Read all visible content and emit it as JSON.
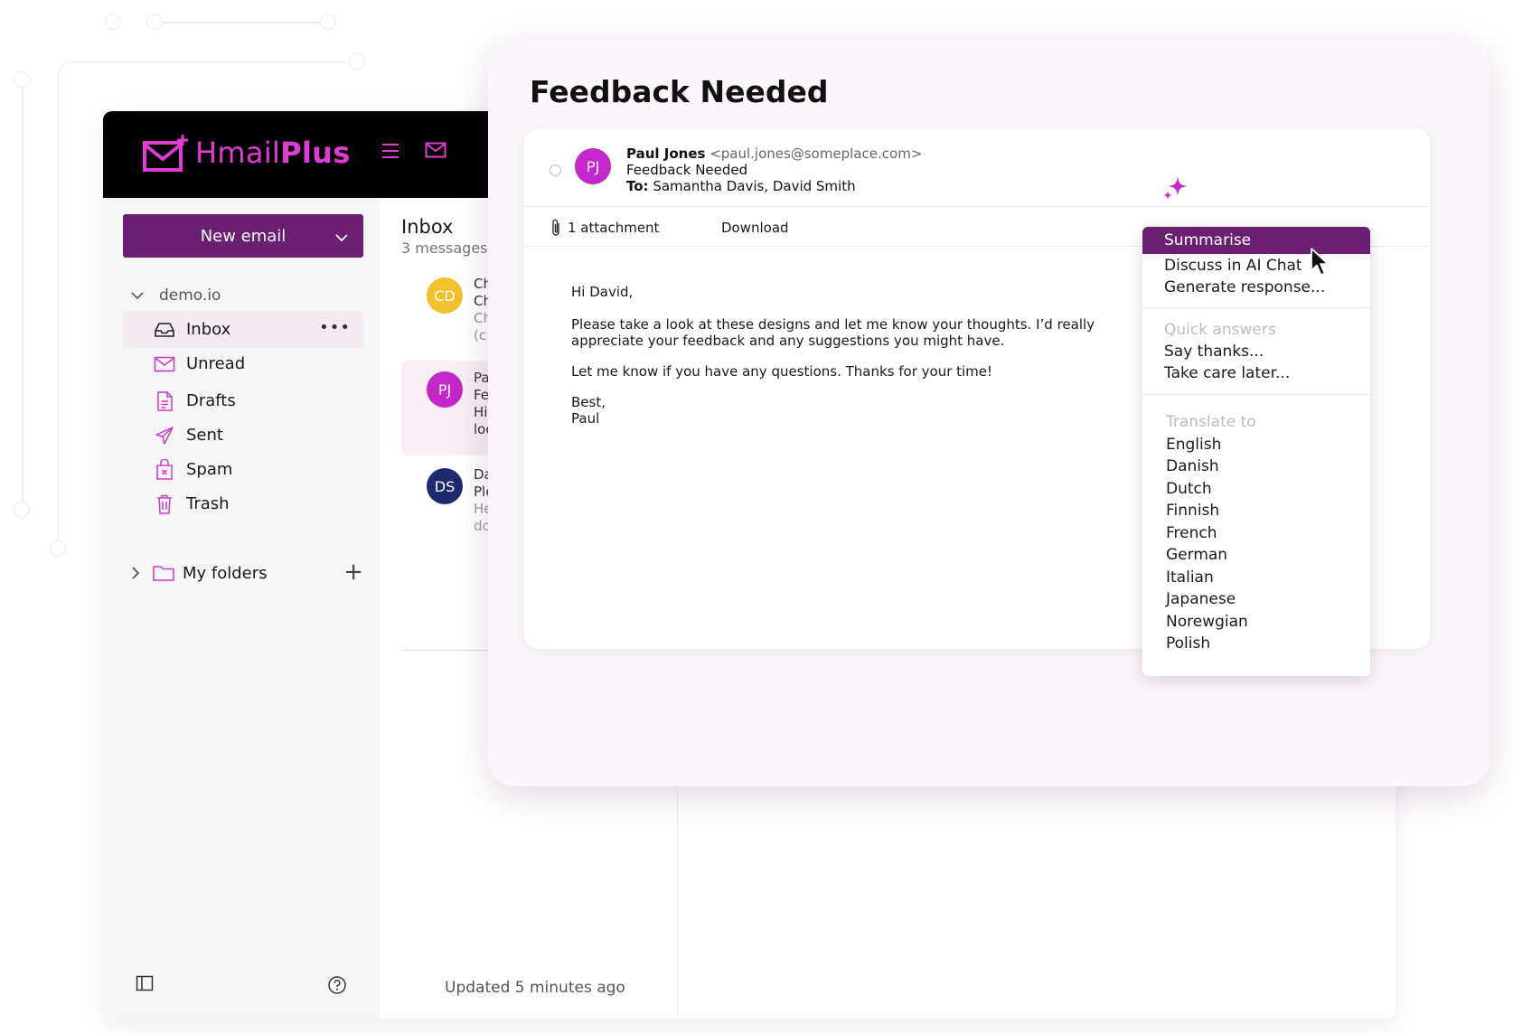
{
  "app": {
    "brand_prefix": "Hmail",
    "brand_suffix": "Plus",
    "accent": "#6b1f72",
    "brand_color": "#e13bd5"
  },
  "sidebar": {
    "new_email": "New email",
    "account": "demo.io",
    "items": [
      {
        "label": "Inbox",
        "icon": "inbox-icon",
        "active": true
      },
      {
        "label": "Unread",
        "icon": "envelope-icon"
      },
      {
        "label": "Drafts",
        "icon": "draft-icon"
      },
      {
        "label": "Sent",
        "icon": "send-icon"
      },
      {
        "label": "Spam",
        "icon": "spam-icon"
      },
      {
        "label": "Trash",
        "icon": "trash-icon"
      }
    ],
    "folders": "My folders",
    "more": "•••"
  },
  "list": {
    "title": "Inbox",
    "count": "3 messages",
    "messages": [
      {
        "initials": "CD",
        "color": "#f2c12e",
        "lines": [
          "Ch",
          "Ch",
          "Ch",
          "(c"
        ]
      },
      {
        "initials": "PJ",
        "color": "#c327c8",
        "lines": [
          "Pa",
          "Fe",
          "Hi",
          "loo"
        ]
      },
      {
        "initials": "DS",
        "color": "#1e2a6e",
        "lines": [
          "Da",
          "Ple",
          "He",
          "do"
        ]
      }
    ],
    "updated": "Updated 5 minutes ago"
  },
  "email": {
    "page_title": "Feedback Needed",
    "avatar": "PJ",
    "sender_name": "Paul Jones",
    "sender_email": "<paul.jones@someplace.com>",
    "subject": "Feedback Needed",
    "to_label": "To:",
    "to_value": "Samantha Davis, David Smith",
    "attachment": "1 attachment",
    "download": "Download",
    "greeting": "Hi David,",
    "para1": "Please take a look at these designs and let me know your thoughts. I’d really appreciate your feedback and any suggestions you might have.",
    "para2": "Let me know if you have any questions. Thanks for your time!",
    "signoff": "Best,",
    "signature": "Paul"
  },
  "ai_menu": {
    "actions": [
      "Summarise",
      "Discuss in AI Chat",
      "Generate response..."
    ],
    "quick_header": "Quick answers",
    "quick": [
      "Say thanks...",
      "Take care later..."
    ],
    "translate_header": "Translate to",
    "languages": [
      "English",
      "Danish",
      "Dutch",
      "Finnish",
      "French",
      "German",
      "Italian",
      "Japanese",
      "Norewgian",
      "Polish"
    ]
  }
}
